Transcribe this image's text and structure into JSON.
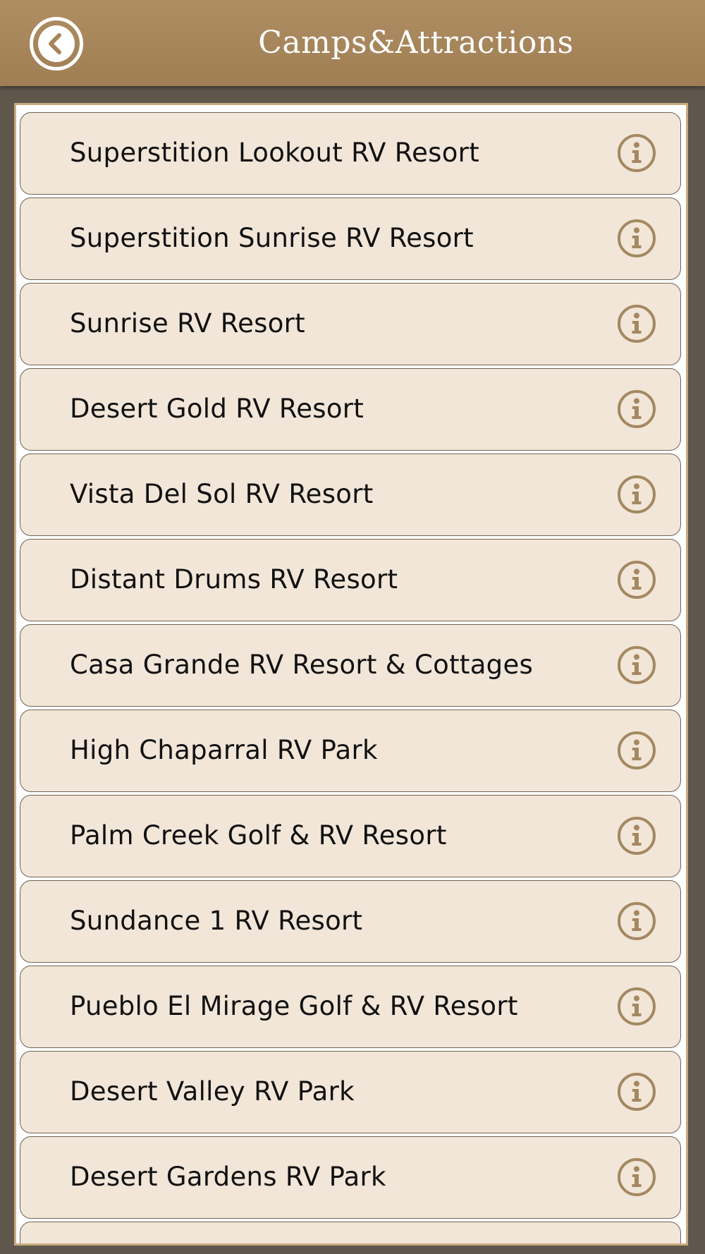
{
  "header": {
    "title": "Camps&Attractions",
    "back_icon": "back-arrow-icon"
  },
  "colors": {
    "header_bg": "#a6845a",
    "frame_bg": "#5f574b",
    "row_bg": "#f1e6d8",
    "icon": "#a48860"
  },
  "list": {
    "items": [
      {
        "label": "Superstition Lookout RV Resort",
        "icon": "info-icon"
      },
      {
        "label": "Superstition Sunrise RV Resort",
        "icon": "info-icon"
      },
      {
        "label": "Sunrise RV Resort",
        "icon": "info-icon"
      },
      {
        "label": "Desert Gold RV Resort",
        "icon": "info-icon"
      },
      {
        "label": "Vista Del Sol RV Resort",
        "icon": "info-icon"
      },
      {
        "label": "Distant Drums RV Resort",
        "icon": "info-icon"
      },
      {
        "label": "Casa Grande RV Resort & Cottages",
        "icon": "info-icon"
      },
      {
        "label": "High Chaparral RV Park",
        "icon": "info-icon"
      },
      {
        "label": "Palm Creek Golf & RV Resort",
        "icon": "info-icon"
      },
      {
        "label": "Sundance 1 RV Resort",
        "icon": "info-icon"
      },
      {
        "label": "Pueblo El Mirage Golf & RV Resort",
        "icon": "info-icon"
      },
      {
        "label": "Desert Valley RV Park",
        "icon": "info-icon"
      },
      {
        "label": "Desert Gardens RV Park",
        "icon": "info-icon"
      },
      {
        "label": "",
        "icon": ""
      }
    ]
  }
}
